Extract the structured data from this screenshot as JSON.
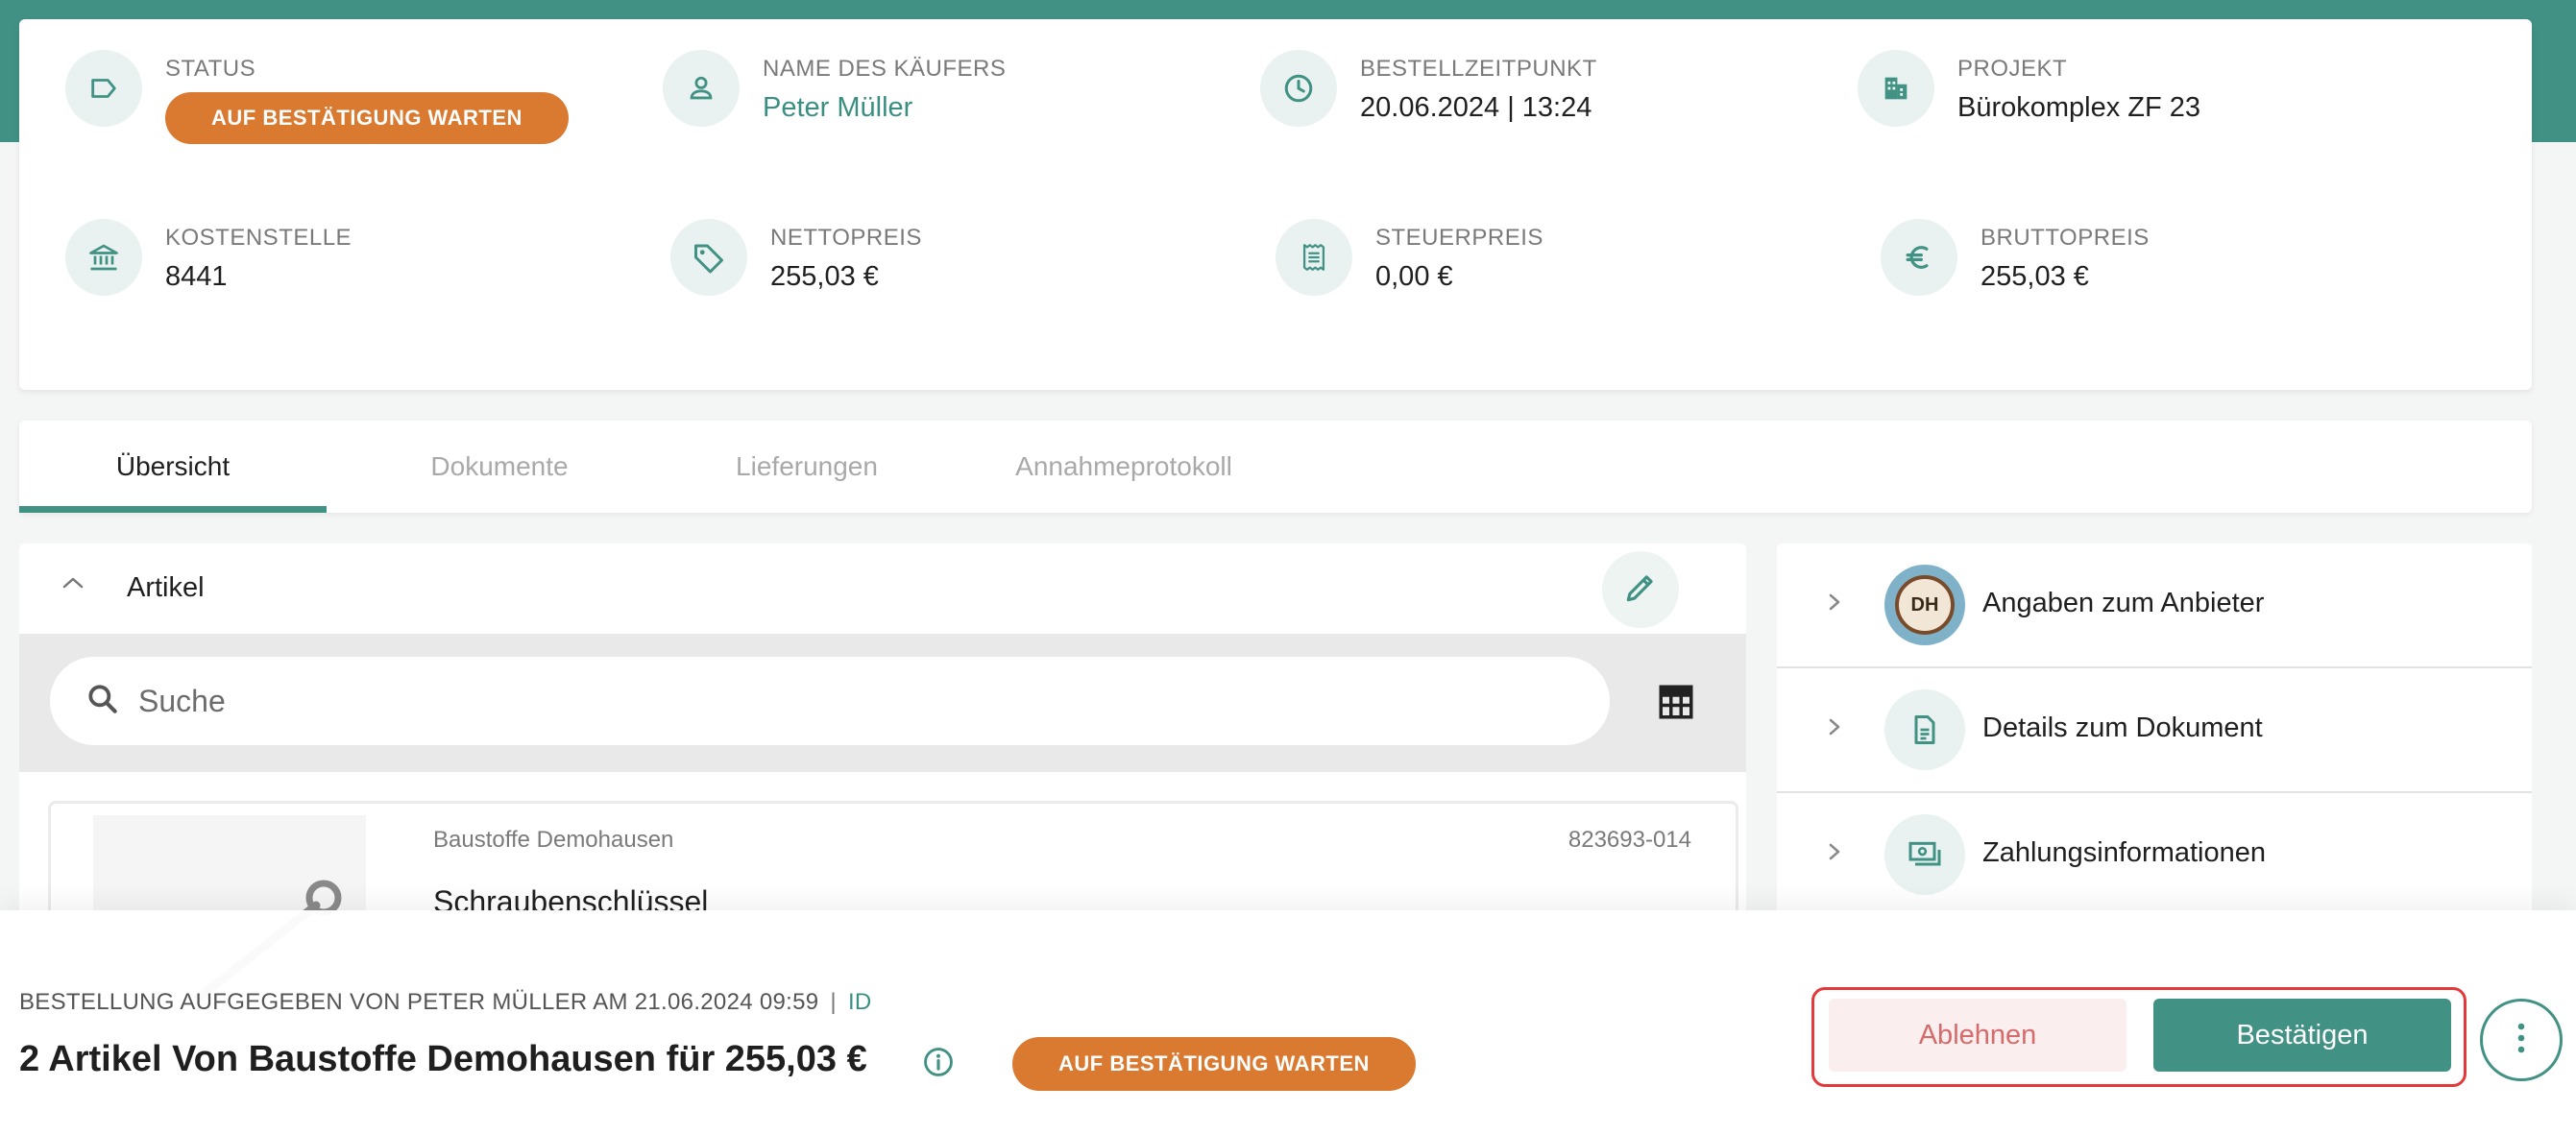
{
  "colors": {
    "brand": "#419184",
    "status_pending": "#D97A30",
    "reject": "#D56B6B",
    "highlight_frame": "#E23A3A"
  },
  "summary": {
    "status": {
      "label": "STATUS",
      "value": "AUF BESTÄTIGUNG WARTEN",
      "icon": "label-tag-icon"
    },
    "buyer": {
      "label": "NAME DES KÄUFERS",
      "value": "Peter Müller",
      "icon": "person-icon"
    },
    "ordered_at": {
      "label": "BESTELLZEITPUNKT",
      "value": "20.06.2024 | 13:24",
      "icon": "clock-icon"
    },
    "project": {
      "label": "PROJEKT",
      "value": "Bürokomplex ZF 23",
      "icon": "building-icon"
    },
    "cost_center": {
      "label": "KOSTENSTELLE",
      "value": "8441",
      "icon": "bank-icon"
    },
    "net_price": {
      "label": "NETTOPREIS",
      "value": "255,03 €",
      "icon": "price-tag-icon"
    },
    "tax_price": {
      "label": "STEUERPREIS",
      "value": "0,00 €",
      "icon": "receipt-icon"
    },
    "gross_price": {
      "label": "BRUTTOPREIS",
      "value": "255,03 €",
      "icon": "euro-icon"
    }
  },
  "tabs": [
    {
      "label": "Übersicht",
      "active": true
    },
    {
      "label": "Dokumente",
      "active": false
    },
    {
      "label": "Lieferungen",
      "active": false
    },
    {
      "label": "Annahmeprotokoll",
      "active": false
    }
  ],
  "articles": {
    "title": "Artikel",
    "search_placeholder": "Suche",
    "items": [
      {
        "vendor": "Baustoffe Demohausen",
        "sku": "823693-014",
        "name": "Schraubenschlüssel"
      }
    ]
  },
  "side_panel": {
    "items": [
      {
        "label": "Angaben zum Anbieter",
        "icon": "vendor-logo"
      },
      {
        "label": "Details zum Dokument",
        "icon": "document-icon"
      },
      {
        "label": "Zahlungsinformationen",
        "icon": "payment-icon"
      }
    ],
    "logo_text": "DH"
  },
  "bottom_bar": {
    "placed_by": "BESTELLUNG AUFGEGEBEN VON PETER MÜLLER AM 21.06.2024 09:59",
    "separator": "|",
    "id_link": "ID",
    "summary": "2 Artikel Von Baustoffe Demohausen für 255,03 €",
    "status": "AUF BESTÄTIGUNG WARTEN",
    "reject_label": "Ablehnen",
    "confirm_label": "Bestätigen"
  }
}
